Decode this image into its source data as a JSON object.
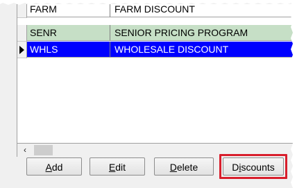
{
  "grid": {
    "rows": [
      {
        "code": "FARM",
        "description": "FARM DISCOUNT",
        "state": "partial"
      },
      {
        "code": "SENR",
        "description": "SENIOR PRICING PROGRAM",
        "state": "alternate"
      },
      {
        "code": "WHLS",
        "description": "WHOLESALE DISCOUNT",
        "state": "selected"
      }
    ]
  },
  "scrollbar": {
    "left_arrow": "‹"
  },
  "buttons": {
    "add": {
      "mnemonic": "A",
      "rest": "dd"
    },
    "edit": {
      "mnemonic": "E",
      "rest": "dit"
    },
    "delete": {
      "mnemonic": "D",
      "rest": "elete"
    },
    "discounts": {
      "pre": "D",
      "mnemonic": "i",
      "rest": "scounts"
    }
  },
  "colors": {
    "selected_row": "#0000ff",
    "alternate_row": "#c6dfc6",
    "highlight_outline": "#d81e2c"
  }
}
